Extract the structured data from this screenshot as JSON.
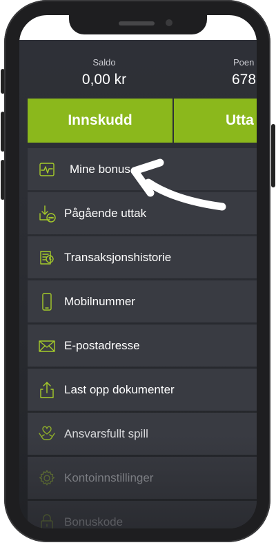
{
  "balances": {
    "saldo_label": "Saldo",
    "saldo_value": "0,00 kr",
    "poeng_label": "Poen",
    "poeng_value": "678"
  },
  "actions": {
    "deposit_label": "Innskudd",
    "withdraw_label": "Utta"
  },
  "menu": {
    "items": [
      {
        "label": "Mine bonus",
        "icon": "activity-chart-icon"
      },
      {
        "label": "Pågående uttak",
        "icon": "download-pending-icon"
      },
      {
        "label": "Transaksjonshistorie",
        "icon": "receipt-history-icon"
      },
      {
        "label": "Mobilnummer",
        "icon": "mobile-phone-icon"
      },
      {
        "label": "E-postadresse",
        "icon": "envelope-icon"
      },
      {
        "label": "Last opp dokumenter",
        "icon": "upload-icon"
      },
      {
        "label": "Ansvarsfullt spill",
        "icon": "hands-heart-icon"
      },
      {
        "label": "Kontoinnstillinger",
        "icon": "gear-icon"
      },
      {
        "label": "Bonuskode",
        "icon": "lock-icon"
      }
    ]
  },
  "colors": {
    "accent": "#8bb81c",
    "icon_accent": "#a6cc2a",
    "menu_bg": "#393b42",
    "screen_bg": "#2f3138"
  }
}
